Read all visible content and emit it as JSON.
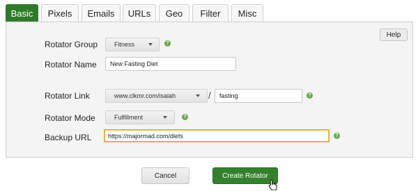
{
  "tabs": [
    {
      "label": "Basic",
      "active": true
    },
    {
      "label": "Pixels",
      "active": false
    },
    {
      "label": "Emails",
      "active": false
    },
    {
      "label": "URLs",
      "active": false
    },
    {
      "label": "Geo",
      "active": false
    },
    {
      "label": "Filter",
      "active": false
    },
    {
      "label": "Misc",
      "active": false
    }
  ],
  "help_label": "Help",
  "form": {
    "rotator_group": {
      "label": "Rotator Group",
      "value": "Fitness"
    },
    "rotator_name": {
      "label": "Rotator Name",
      "value": "New Fasting Diet"
    },
    "rotator_link": {
      "label": "Rotator Link",
      "domain": "www.clkmr.com/isaiah",
      "separator": "/",
      "slug": "fasting"
    },
    "rotator_mode": {
      "label": "Rotator Mode",
      "value": "Fulfillment"
    },
    "backup_url": {
      "label": "Backup URL",
      "value": "https://majormad.com/diets"
    }
  },
  "help_icon_glyph": "?",
  "buttons": {
    "cancel": "Cancel",
    "create": "Create Rotator"
  },
  "colors": {
    "accent_green": "#2f7a2a",
    "focus_outline": "#e5b33a",
    "help_icon": "#6aa84f"
  },
  "icons": [
    "help-question-icon",
    "dropdown-caret-icon",
    "hand-pointer-cursor-icon"
  ]
}
